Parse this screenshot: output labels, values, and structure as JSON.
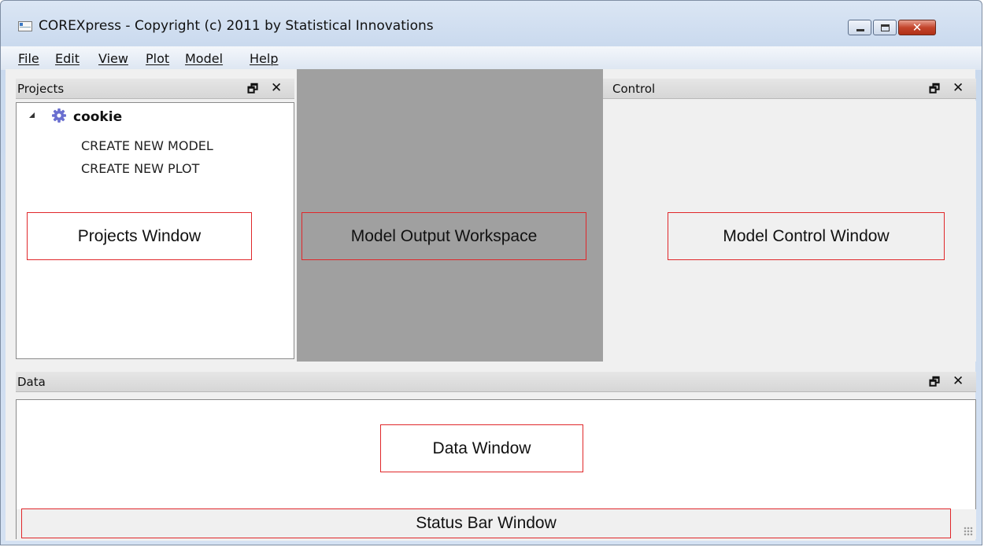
{
  "window": {
    "title": "COREXpress - Copyright (c) 2011 by Statistical Innovations",
    "controls": {
      "minimize": "minimize-icon",
      "maximize": "maximize-icon",
      "close": "close-icon",
      "close_glyph": "✕"
    }
  },
  "menu": {
    "items": [
      {
        "label": "File"
      },
      {
        "label": "Edit"
      },
      {
        "label": "View"
      },
      {
        "label": "Plot"
      },
      {
        "label": "Model"
      },
      {
        "label": "Help"
      }
    ]
  },
  "panels": {
    "projects": {
      "title": "Projects",
      "float_glyph": "🗗",
      "close_glyph": "✕"
    },
    "control": {
      "title": "Control",
      "float_glyph": "🗗",
      "close_glyph": "✕"
    },
    "data": {
      "title": "Data",
      "float_glyph": "🗗",
      "close_glyph": "✕"
    }
  },
  "projects_tree": {
    "root": {
      "label": "cookie",
      "icon": "gear-icon",
      "expanded": true
    },
    "children": [
      {
        "label": "CREATE NEW MODEL"
      },
      {
        "label": "CREATE NEW PLOT"
      }
    ]
  },
  "annotations": {
    "projects": "Projects Window",
    "workspace": "Model Output Workspace",
    "control": "Model Control Window",
    "data": "Data Window",
    "status": "Status Bar Window"
  },
  "colors": {
    "annotation_border": "#e0272a",
    "workspace_bg": "#a0a0a0",
    "gear": "#6a6fd0"
  }
}
